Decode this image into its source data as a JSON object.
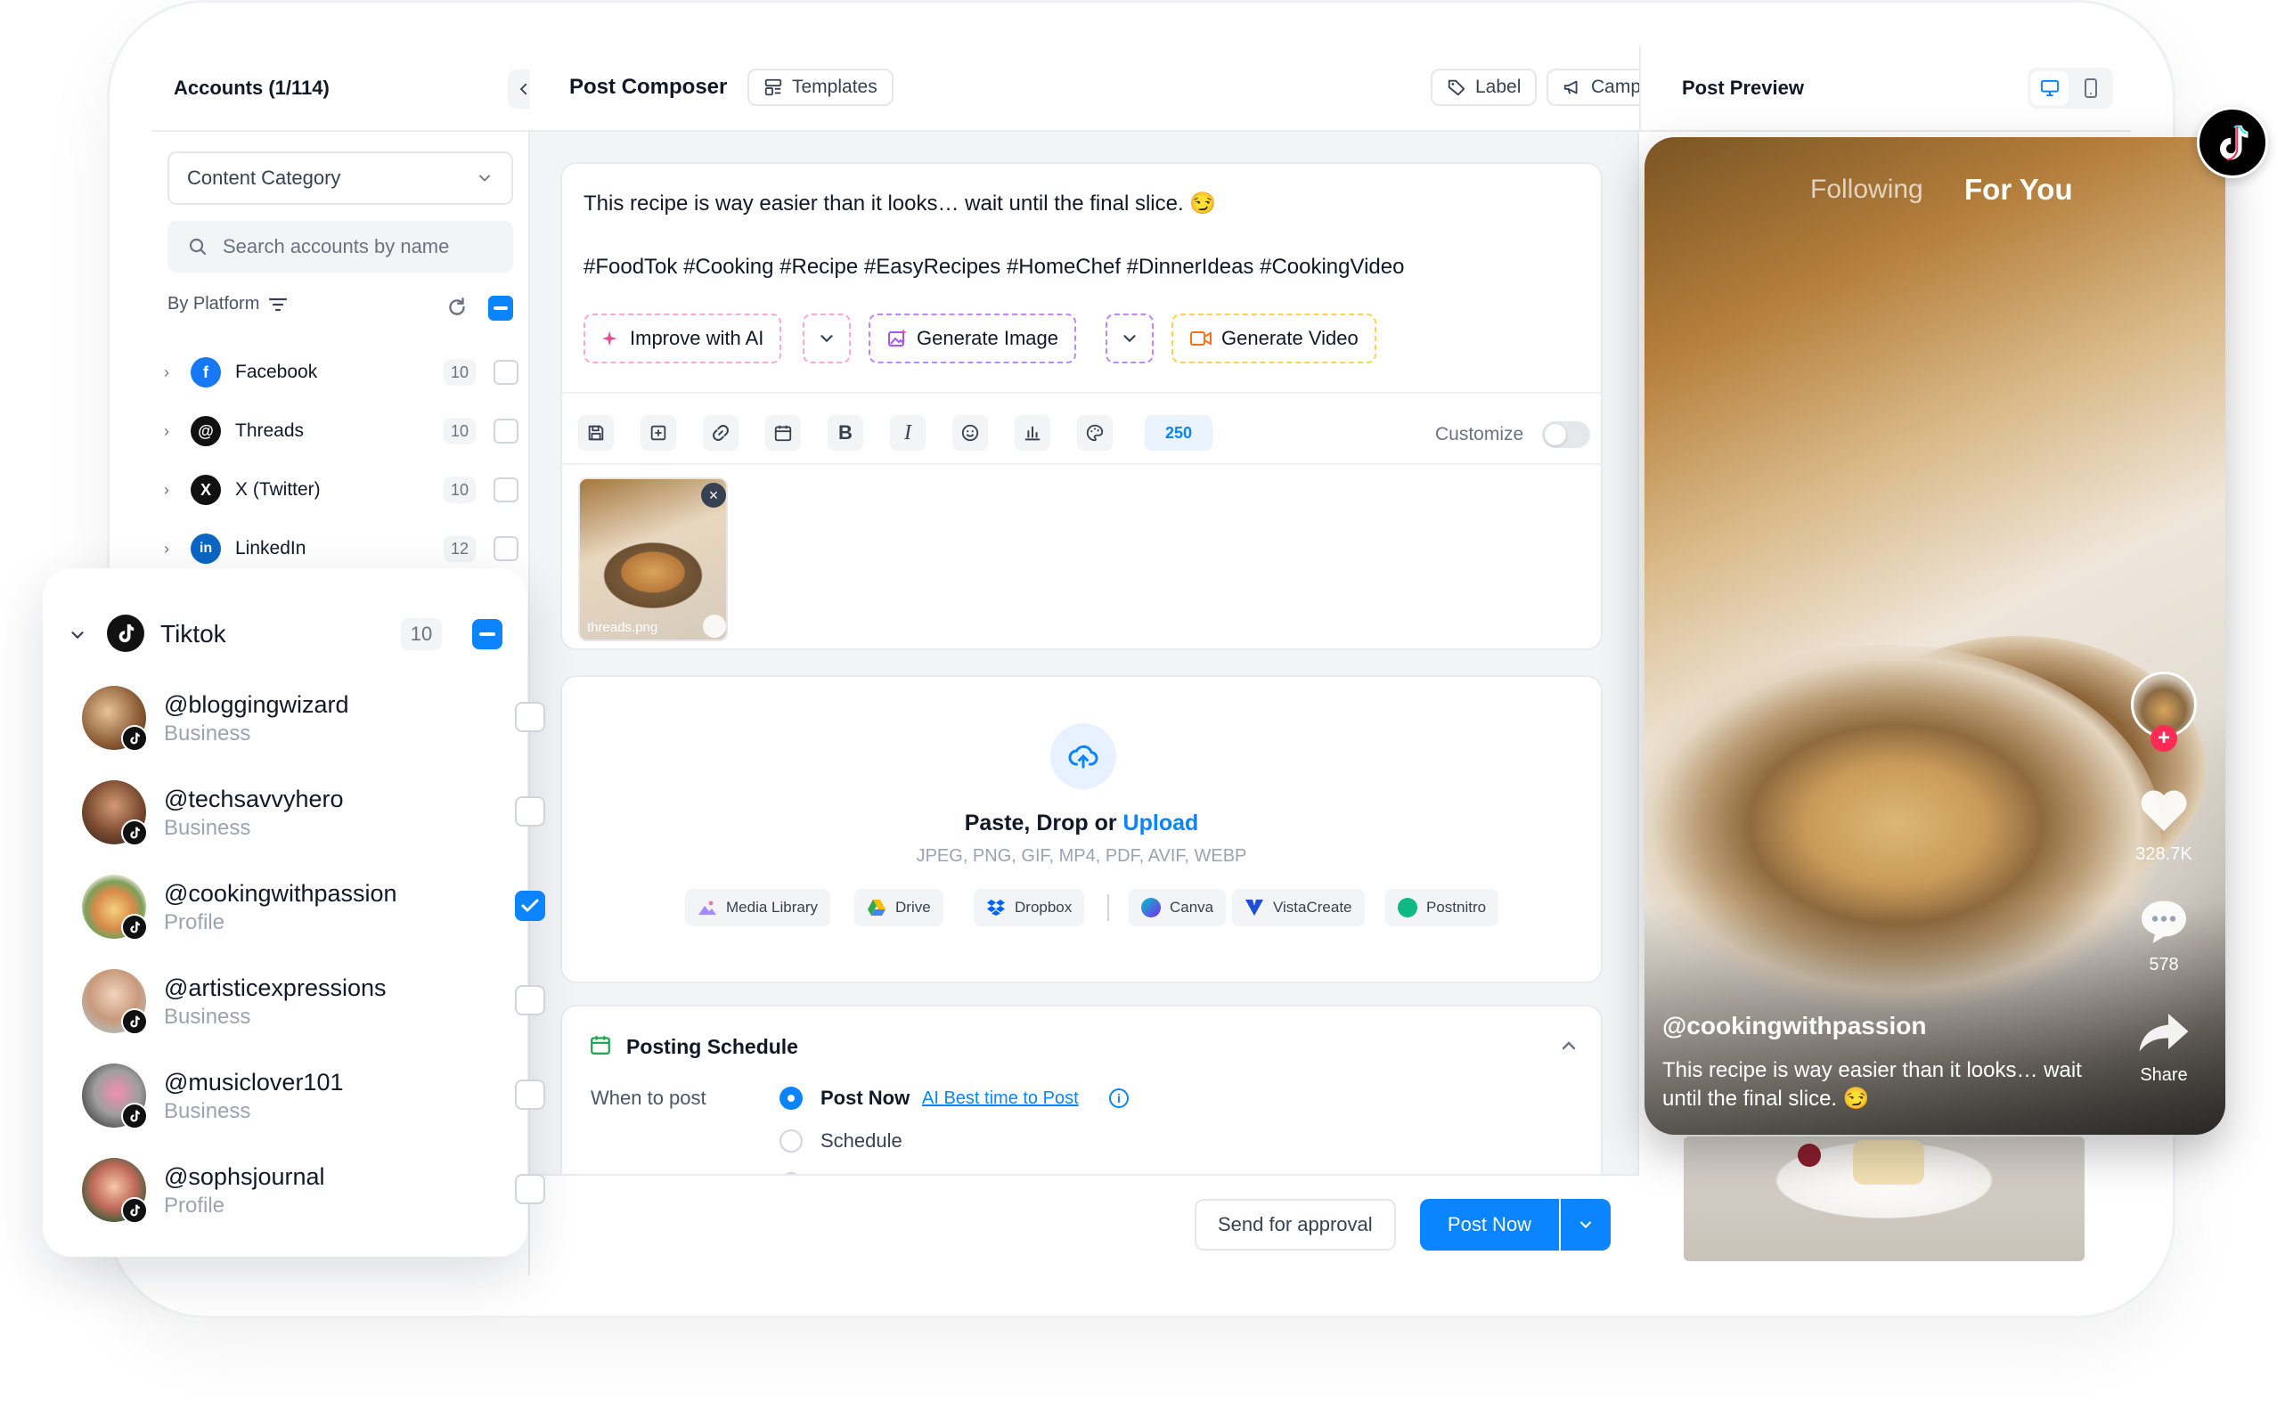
{
  "accounts": {
    "header": "Accounts (1/114)",
    "category_select": "Content Category",
    "search_placeholder": "Search accounts by name",
    "filter_label": "By Platform",
    "platforms": [
      {
        "name": "Facebook",
        "count": "10"
      },
      {
        "name": "Threads",
        "count": "10"
      },
      {
        "name": "X (Twitter)",
        "count": "10"
      },
      {
        "name": "LinkedIn",
        "count": "12"
      }
    ]
  },
  "tiktok_panel": {
    "name": "Tiktok",
    "count": "10",
    "accounts": [
      {
        "handle": "@bloggingwizard",
        "type": "Business",
        "checked": false
      },
      {
        "handle": "@techsavvyhero",
        "type": "Business",
        "checked": false
      },
      {
        "handle": "@cookingwithpassion",
        "type": "Profile",
        "checked": true
      },
      {
        "handle": "@artisticexpressions",
        "type": "Business",
        "checked": false
      },
      {
        "handle": "@musiclover101",
        "type": "Business",
        "checked": false
      },
      {
        "handle": "@sophsjournal",
        "type": "Profile",
        "checked": false
      }
    ]
  },
  "composer": {
    "title": "Post Composer",
    "templates": "Templates",
    "label": "Label",
    "campaign": "Campaign",
    "text_line1": "This recipe is way easier than it looks… wait until the final slice. 😏",
    "text_line2": "#FoodTok #Cooking #Recipe #EasyRecipes #HomeChef #DinnerIdeas #CookingVideo",
    "improve_ai": "Improve with AI",
    "generate_image": "Generate Image",
    "generate_video": "Generate Video",
    "char_count": "250",
    "customize": "Customize",
    "attachment_name": "threads.png"
  },
  "upload": {
    "title_prefix": "Paste, Drop or ",
    "title_link": "Upload",
    "formats": "JPEG, PNG, GIF, MP4, PDF, AVIF, WEBP",
    "sources": [
      "Media Library",
      "Drive",
      "Dropbox",
      "Canva",
      "VistaCreate",
      "Postnitro"
    ]
  },
  "schedule": {
    "title": "Posting Schedule",
    "when_label": "When to post",
    "post_now": "Post Now",
    "ai_best": "AI Best time to Post",
    "schedule": "Schedule"
  },
  "footer": {
    "send_approval": "Send for approval",
    "post_now": "Post Now"
  },
  "preview": {
    "title": "Post Preview",
    "tab_following": "Following",
    "tab_for_you": "For You",
    "likes": "328.7K",
    "comments": "578",
    "share": "Share",
    "handle": "@cookingwithpassion",
    "caption": "This recipe is way easier than it looks… wait until the final slice. 😏"
  },
  "colors": {
    "accent": "#0a84ff",
    "schedule_icon": "#16a34a",
    "ai_pink": "#f472b6",
    "ai_purple": "#a855f7",
    "video_orange": "#f59e0b"
  }
}
